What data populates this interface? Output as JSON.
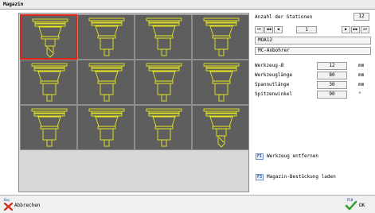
{
  "window": {
    "title": "Magazin"
  },
  "colors": {
    "tool_stroke": "#e8e81c",
    "cell_bg": "#5e5e5e",
    "selected_border": "#d8261a",
    "panel_bg": "#d8d8d8"
  },
  "magazine": {
    "stations": [
      {
        "tool": "drill"
      },
      {
        "tool": "holder"
      },
      {
        "tool": "holder"
      },
      {
        "tool": "holder"
      },
      {
        "tool": "holder"
      },
      {
        "tool": "holder"
      },
      {
        "tool": "holder"
      },
      {
        "tool": "holder"
      },
      {
        "tool": "holder"
      },
      {
        "tool": "holder"
      },
      {
        "tool": "holder"
      },
      {
        "tool": "drill"
      }
    ],
    "selected_index": 0
  },
  "right_panel": {
    "stations_label": "Anzahl der Stationen",
    "stations_count": "12",
    "nav": {
      "first": "⏮",
      "prev_page": "◀◀",
      "prev": "◀",
      "current": "1",
      "next": "▶",
      "next_page": "▶▶",
      "last": "⏭"
    },
    "tool_id": "MOA12",
    "tool_type": "MC-Anbohrer",
    "params": [
      {
        "label": "Werkzeug-Ø",
        "value": "12",
        "unit": "mm"
      },
      {
        "label": "Werkzeuglänge",
        "value": "80",
        "unit": "mm"
      },
      {
        "label": "Spannutlänge",
        "value": "30",
        "unit": "mm"
      },
      {
        "label": "Spitzenwinkel",
        "value": "90",
        "unit": "°"
      }
    ],
    "f1_key": "F1",
    "f1_label": "Werkzeug entfernen",
    "f3_key": "F3",
    "f3_label": "Magazin-Bestückung laden"
  },
  "bottom": {
    "esc_key": "Esc",
    "cancel_label": "Abbrechen",
    "ok_key": "F10",
    "ok_label": "OK"
  }
}
